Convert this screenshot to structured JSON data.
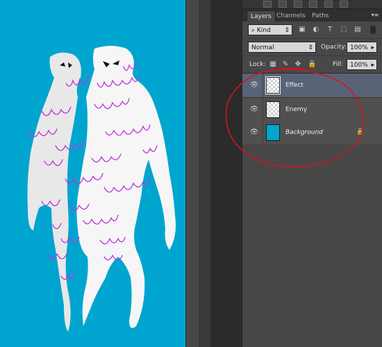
{
  "colors": {
    "canvas_bg": "#00a5cf",
    "ghost": "#f4f4f4",
    "scribble": "#c02ee0",
    "annotation": "#d2141f",
    "selected_layer": "#596377"
  },
  "tabs": [
    {
      "label": "Layers",
      "active": true
    },
    {
      "label": "Channels",
      "active": false
    },
    {
      "label": "Paths",
      "active": false
    }
  ],
  "panel_menu_icon": "panel-menu-icon",
  "filter": {
    "kind_label": "Kind",
    "icons": [
      "image-filter-icon",
      "adjustment-filter-icon",
      "type-filter-icon",
      "shape-filter-icon",
      "smart-object-filter-icon"
    ]
  },
  "blend": {
    "mode": "Normal",
    "opacity_label": "Opacity:",
    "opacity_value": "100%"
  },
  "lock": {
    "label": "Lock:",
    "fill_label": "Fill:",
    "fill_value": "100%",
    "icons": [
      "lock-transparent-icon",
      "lock-paint-icon",
      "lock-move-icon",
      "lock-all-icon"
    ]
  },
  "layers": [
    {
      "name": "Effect",
      "selected": true,
      "thumb": "transparent",
      "locked": false,
      "italic": false
    },
    {
      "name": "Enemy",
      "selected": false,
      "thumb": "transparent",
      "locked": false,
      "italic": false
    },
    {
      "name": "Background",
      "selected": false,
      "thumb": "cyan",
      "locked": true,
      "italic": true
    }
  ]
}
